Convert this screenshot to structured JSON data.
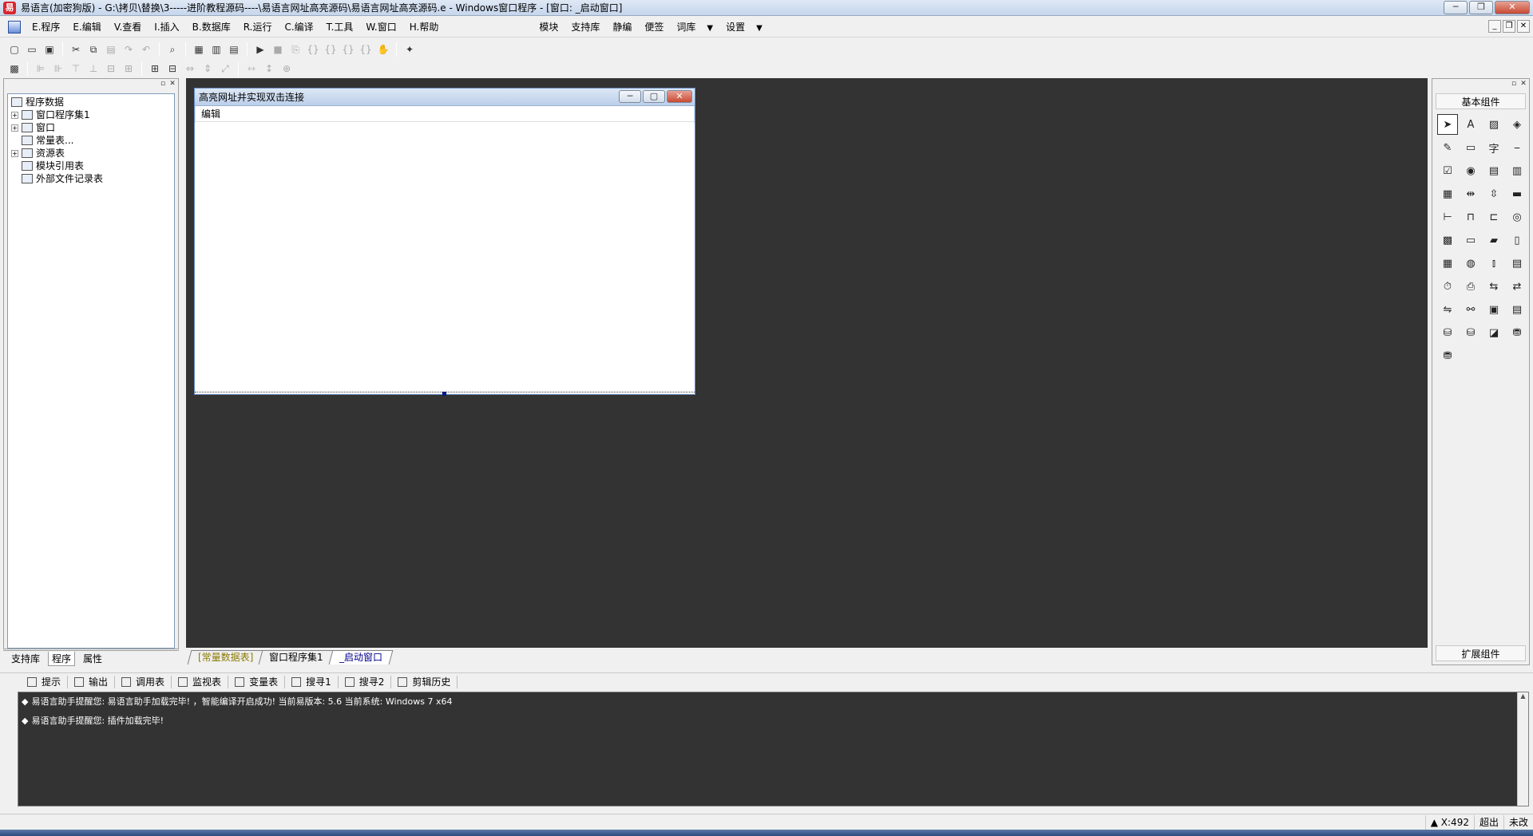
{
  "title_bar": {
    "title": "易语言(加密狗版) - G:\\拷贝\\替换\\3-----进阶教程源码----\\易语言网址高亮源码\\易语言网址高亮源码.e - Windows窗口程序 - [窗口: _启动窗口]"
  },
  "menu": {
    "items": [
      "E.程序",
      "E.编辑",
      "V.查看",
      "I.插入",
      "B.数据库",
      "R.运行",
      "C.编译",
      "T.工具",
      "W.窗口",
      "H.帮助"
    ],
    "extra": [
      "模块",
      "支持库",
      "静编",
      "便签",
      "词库",
      "设置"
    ]
  },
  "left_panel": {
    "tree": {
      "root": "程序数据",
      "children": [
        "窗口程序集1",
        "窗口",
        "常量表...",
        "资源表",
        "模块引用表",
        "外部文件记录表"
      ]
    },
    "tabs": [
      "支持库",
      "程序",
      "属性"
    ]
  },
  "form": {
    "title": "高亮网址并实现双击连接",
    "menu": "编辑"
  },
  "editor_tabs": [
    "[常量数据表]",
    "窗口程序集1",
    "_启动窗口"
  ],
  "right_panel": {
    "header": "基本组件",
    "footer": "扩展组件"
  },
  "output": {
    "tabs": [
      "提示",
      "输出",
      "调用表",
      "监视表",
      "变量表",
      "搜寻1",
      "搜寻2",
      "剪辑历史"
    ],
    "lines": [
      "易语言助手提醒您: 易语言助手加载完毕! ，智能编译开启成功! 当前易版本: 5.6 当前系统: Windows 7 x64",
      "易语言助手提醒您: 插件加载完毕!"
    ]
  },
  "status": {
    "coord": "X:492",
    "mode": "超出",
    "state": "未改"
  },
  "icons": {
    "app": "yi-language-logo-icon",
    "colors": {
      "editor_bg": "#333333",
      "active_tab": "#00008b",
      "const_tab": "#8a7a00"
    }
  }
}
